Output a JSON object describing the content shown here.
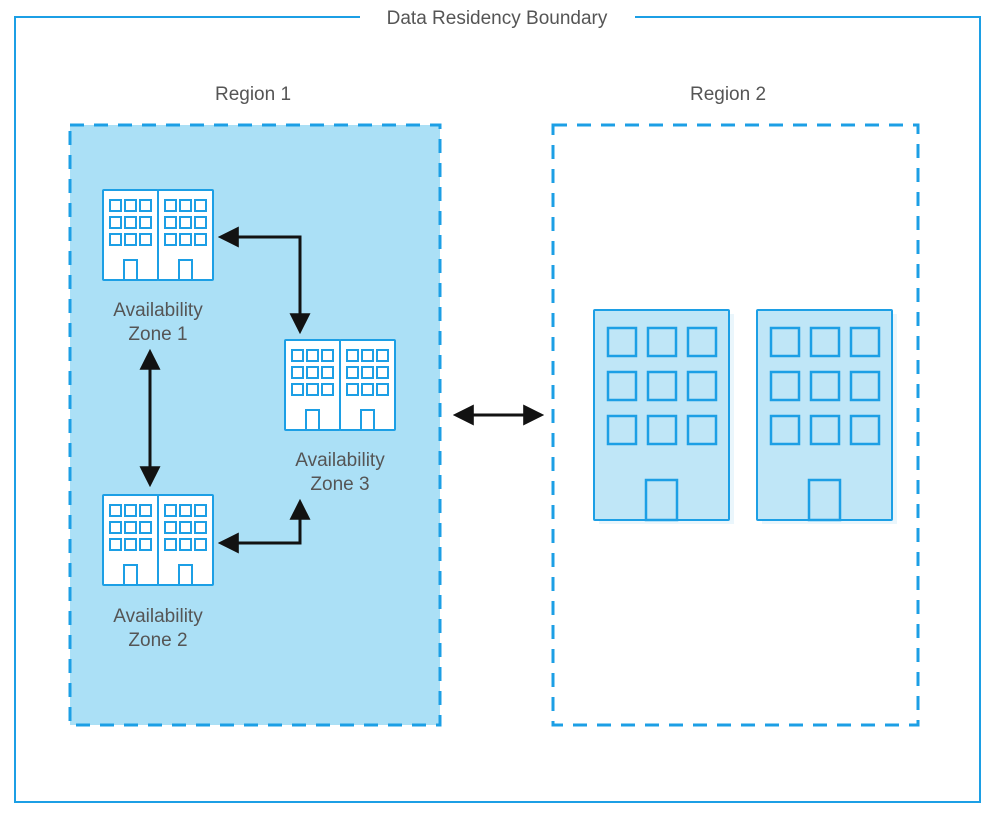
{
  "title": "Data Residency Boundary",
  "regions": [
    {
      "label": "Region 1",
      "zones": [
        {
          "label_line1": "Availability",
          "label_line2": "Zone 1"
        },
        {
          "label_line1": "Availability",
          "label_line2": "Zone 2"
        },
        {
          "label_line1": "Availability",
          "label_line2": "Zone 3"
        }
      ]
    },
    {
      "label": "Region 2"
    }
  ],
  "colors": {
    "azure_stroke": "#1C9FE5",
    "azure_fill_light": "#BFE6F7",
    "azure_fill_lighter": "#D6EEFA",
    "azure_fill_box": "#ABE0F6",
    "arrow": "#121212"
  }
}
